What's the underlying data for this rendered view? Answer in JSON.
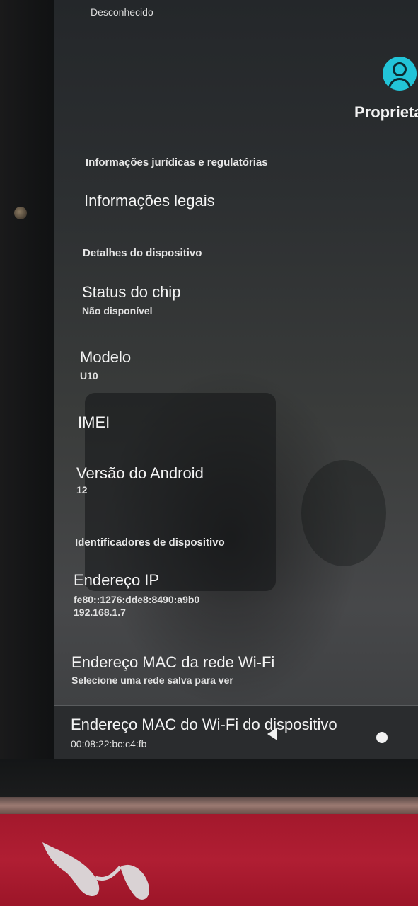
{
  "top_item_subtitle": "Desconhecido",
  "account": {
    "icon": "account-circle-icon",
    "label": "Proprieta",
    "accent_color": "#22c4d8"
  },
  "sections": {
    "legal_header": "Informações jurídicas e regulatórias",
    "device_details_header": "Detalhes do dispositivo",
    "identifiers_header": "Identificadores de dispositivo"
  },
  "items": {
    "legal_info": {
      "title": "Informações legais"
    },
    "chip_status": {
      "title": "Status do chip",
      "value": "Não disponível"
    },
    "model": {
      "title": "Modelo",
      "value": "U10"
    },
    "imei": {
      "title": "IMEI"
    },
    "android_version": {
      "title": "Versão do Android",
      "value": "12"
    },
    "ip_address": {
      "title": "Endereço IP",
      "value_line1": "fe80::1276:dde8:8490:a9b0",
      "value_line2": "192.168.1.7"
    },
    "wifi_mac": {
      "title": "Endereço MAC da rede Wi-Fi",
      "value": "Selecione uma rede salva para ver"
    },
    "device_wifi_mac": {
      "title": "Endereço MAC do Wi-Fi do dispositivo",
      "value": "00:08:22:bc:c4:fb"
    }
  },
  "navigation": {
    "back_icon": "back-triangle-icon",
    "home_icon": "home-circle-icon"
  }
}
